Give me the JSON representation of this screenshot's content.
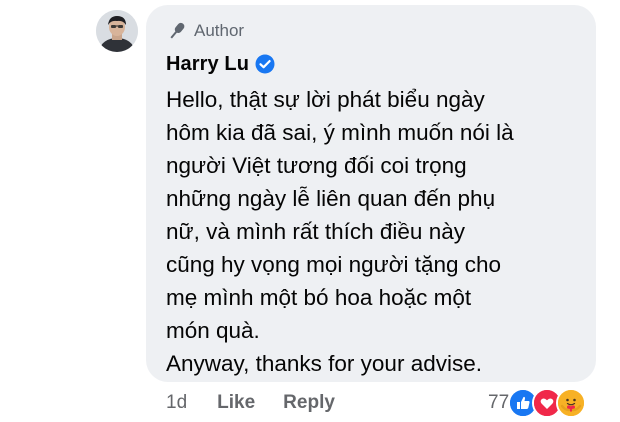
{
  "comment": {
    "badge_label": "Author",
    "author_name": "Harry Lu",
    "lines": [
      "Hello, thật sự lời phát biểu ngày",
      "hôm kia đã sai, ý mình muốn nói là",
      "người Việt tương đối coi trọng",
      "những ngày lễ liên quan đến phụ",
      "nữ, và mình rất thích điều này",
      "cũng hy vọng mọi người tặng cho",
      "mẹ mình một bó hoa hoặc một",
      "món quà.",
      "Anyway, thanks for your advise."
    ],
    "bubble_color": "#eef0f3"
  },
  "actions": {
    "time": "1d",
    "like_label": "Like",
    "reply_label": "Reply"
  },
  "reactions": {
    "count": "77",
    "icons": [
      "like-reaction-icon",
      "love-reaction-icon",
      "care-reaction-icon"
    ],
    "colors": {
      "like": "#1877f2",
      "love": "#f02849",
      "care": "#f7b125"
    }
  },
  "icons": {
    "author_badge": "microphone-icon",
    "verified": "verified-badge-icon",
    "verified_color": "#1877f2"
  }
}
